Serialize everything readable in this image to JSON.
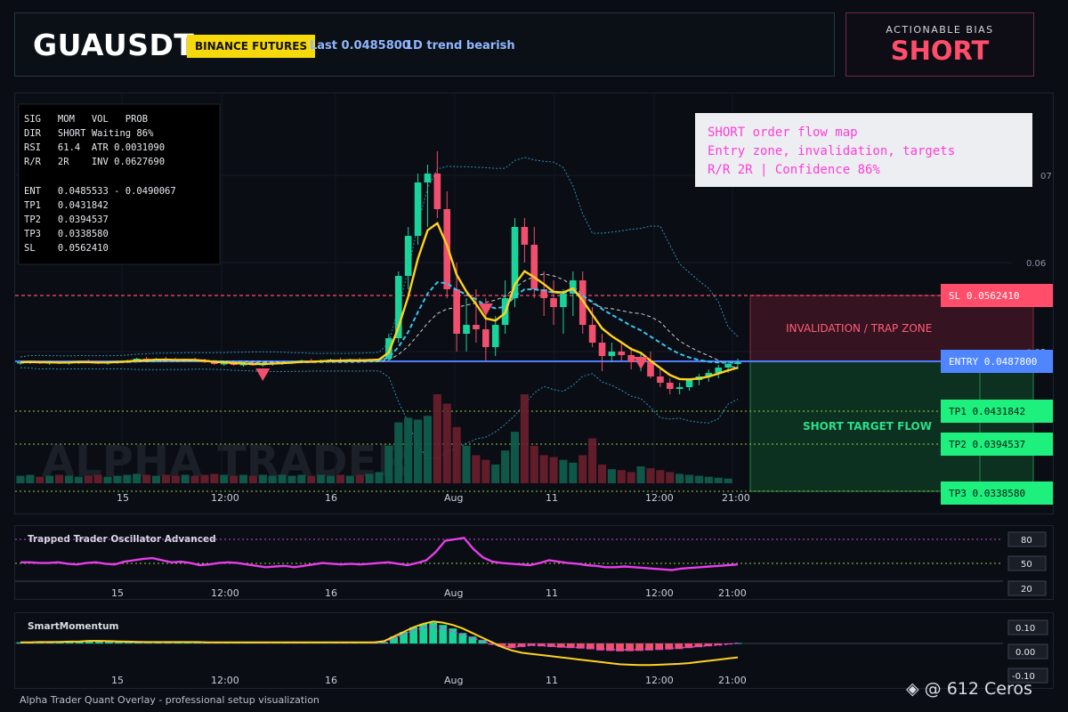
{
  "header": {
    "symbol": "GUAUSDT",
    "exchange": "BINANCE FUTURES",
    "last": "Last 0.0485800",
    "trend": "1D trend bearish"
  },
  "bias": {
    "label": "ACTIONABLE BIAS",
    "value": "SHORT"
  },
  "info_panel": {
    "lines": [
      "SIG   MOM   VOL   PROB",
      "DIR   SHORT Waiting 86%",
      "RSI   61.4  ATR 0.0031090",
      "R/R   2R    INV 0.0627690",
      "",
      "ENT   0.0485533 - 0.0490067",
      "TP1   0.0431842",
      "TP2   0.0394537",
      "TP3   0.0338580",
      "SL    0.0562410"
    ]
  },
  "note_box": {
    "lines": [
      "SHORT order flow map",
      "Entry zone, invalidation, targets",
      "R/R 2R | Confidence 86%"
    ]
  },
  "levels": {
    "sl": {
      "label": "SL 0.0562410",
      "value": 0.056241
    },
    "entry": {
      "label": "ENTRY 0.0487800",
      "value": 0.04878
    },
    "tp1": {
      "label": "TP1 0.0431842",
      "value": 0.0431842
    },
    "tp2": {
      "label": "TP2 0.0394537",
      "value": 0.0394537
    },
    "tp3": {
      "label": "TP3 0.0338580",
      "value": 0.033858
    }
  },
  "zones": {
    "invalidation": "INVALIDATION / TRAP ZONE",
    "target": "SHORT TARGET FLOW"
  },
  "watermark": "ALPHA TRADER",
  "chart_data": [
    {
      "type": "candlestick",
      "title": "GUAUSDT",
      "y_ticks": [
        "0.05",
        "0.06",
        "07"
      ],
      "x_ticks": [
        "15",
        "12:00",
        "16",
        "Aug",
        "11",
        "12:00",
        "21:00"
      ],
      "ohlc": [
        [
          0.0487,
          0.0489,
          0.0485,
          0.0488
        ],
        [
          0.0488,
          0.049,
          0.0486,
          0.0489
        ],
        [
          0.0489,
          0.049,
          0.0486,
          0.0487
        ],
        [
          0.0487,
          0.0489,
          0.0485,
          0.0488
        ],
        [
          0.0488,
          0.049,
          0.0486,
          0.0487
        ],
        [
          0.0487,
          0.0489,
          0.0485,
          0.0488
        ],
        [
          0.0488,
          0.049,
          0.0486,
          0.0489
        ],
        [
          0.0489,
          0.0491,
          0.0487,
          0.0488
        ],
        [
          0.0488,
          0.049,
          0.0486,
          0.0487
        ],
        [
          0.0487,
          0.0489,
          0.0485,
          0.0488
        ],
        [
          0.0488,
          0.049,
          0.0486,
          0.0489
        ],
        [
          0.0489,
          0.0491,
          0.0487,
          0.049
        ],
        [
          0.049,
          0.0493,
          0.0488,
          0.0492
        ],
        [
          0.0492,
          0.0494,
          0.049,
          0.0491
        ],
        [
          0.0491,
          0.0493,
          0.0489,
          0.0492
        ],
        [
          0.0492,
          0.0494,
          0.049,
          0.0491
        ],
        [
          0.0491,
          0.0493,
          0.0489,
          0.049
        ],
        [
          0.049,
          0.0492,
          0.0488,
          0.0491
        ],
        [
          0.0491,
          0.0493,
          0.0489,
          0.049
        ],
        [
          0.049,
          0.0492,
          0.0487,
          0.0488
        ],
        [
          0.0488,
          0.049,
          0.0485,
          0.0486
        ],
        [
          0.0486,
          0.0488,
          0.0484,
          0.0487
        ],
        [
          0.0487,
          0.0489,
          0.0484,
          0.0485
        ],
        [
          0.0485,
          0.0487,
          0.0483,
          0.0486
        ],
        [
          0.0486,
          0.0488,
          0.0484,
          0.0485
        ],
        [
          0.0485,
          0.0487,
          0.0483,
          0.0486
        ],
        [
          0.0486,
          0.0488,
          0.0484,
          0.0487
        ],
        [
          0.0487,
          0.0489,
          0.0485,
          0.0488
        ],
        [
          0.0488,
          0.049,
          0.0486,
          0.0489
        ],
        [
          0.0489,
          0.0491,
          0.0487,
          0.049
        ],
        [
          0.049,
          0.0492,
          0.0488,
          0.0489
        ],
        [
          0.0489,
          0.0491,
          0.0487,
          0.049
        ],
        [
          0.049,
          0.0492,
          0.0488,
          0.0491
        ],
        [
          0.0491,
          0.0493,
          0.0489,
          0.049
        ],
        [
          0.049,
          0.0492,
          0.0488,
          0.0491
        ],
        [
          0.0491,
          0.0493,
          0.0489,
          0.049
        ],
        [
          0.049,
          0.0492,
          0.0488,
          0.0491
        ],
        [
          0.0491,
          0.0493,
          0.0489,
          0.0492
        ],
        [
          0.0492,
          0.052,
          0.049,
          0.0515
        ],
        [
          0.0515,
          0.059,
          0.051,
          0.0585
        ],
        [
          0.0585,
          0.064,
          0.057,
          0.063
        ],
        [
          0.063,
          0.07,
          0.062,
          0.069
        ],
        [
          0.069,
          0.071,
          0.064,
          0.07
        ],
        [
          0.07,
          0.0725,
          0.065,
          0.066
        ],
        [
          0.066,
          0.068,
          0.056,
          0.057
        ],
        [
          0.057,
          0.06,
          0.05,
          0.052
        ],
        [
          0.052,
          0.056,
          0.05,
          0.053
        ],
        [
          0.053,
          0.057,
          0.051,
          0.0525
        ],
        [
          0.0525,
          0.056,
          0.049,
          0.0505
        ],
        [
          0.0505,
          0.054,
          0.0495,
          0.053
        ],
        [
          0.053,
          0.058,
          0.052,
          0.056
        ],
        [
          0.056,
          0.065,
          0.055,
          0.064
        ],
        [
          0.064,
          0.065,
          0.06,
          0.062
        ],
        [
          0.062,
          0.064,
          0.056,
          0.057
        ],
        [
          0.057,
          0.059,
          0.054,
          0.056
        ],
        [
          0.056,
          0.058,
          0.053,
          0.055
        ],
        [
          0.055,
          0.057,
          0.052,
          0.0565
        ],
        [
          0.0565,
          0.059,
          0.054,
          0.058
        ],
        [
          0.058,
          0.059,
          0.052,
          0.053
        ],
        [
          0.053,
          0.055,
          0.0505,
          0.051
        ],
        [
          0.051,
          0.052,
          0.0478,
          0.0495
        ],
        [
          0.0495,
          0.051,
          0.0488,
          0.05
        ],
        [
          0.05,
          0.051,
          0.049,
          0.0496
        ],
        [
          0.0496,
          0.0505,
          0.048,
          0.0488
        ],
        [
          0.0488,
          0.05,
          0.0478,
          0.049
        ],
        [
          0.049,
          0.05,
          0.047,
          0.0472
        ],
        [
          0.0472,
          0.048,
          0.046,
          0.0465
        ],
        [
          0.0465,
          0.047,
          0.0452,
          0.0458
        ],
        [
          0.0458,
          0.0465,
          0.0452,
          0.046
        ],
        [
          0.046,
          0.047,
          0.0456,
          0.0468
        ],
        [
          0.0468,
          0.0475,
          0.0462,
          0.0472
        ],
        [
          0.0472,
          0.048,
          0.0466,
          0.0476
        ],
        [
          0.0476,
          0.0485,
          0.047,
          0.0482
        ],
        [
          0.0482,
          0.049,
          0.0476,
          0.0486
        ],
        [
          0.0486,
          0.0492,
          0.048,
          0.0488
        ]
      ],
      "volume": [
        8,
        9,
        7,
        8,
        9,
        8,
        7,
        8,
        9,
        7,
        8,
        9,
        10,
        9,
        8,
        9,
        8,
        9,
        8,
        9,
        10,
        9,
        8,
        9,
        8,
        9,
        8,
        9,
        8,
        9,
        8,
        9,
        8,
        9,
        8,
        9,
        10,
        12,
        40,
        65,
        70,
        68,
        72,
        95,
        85,
        60,
        40,
        30,
        25,
        20,
        35,
        55,
        95,
        40,
        30,
        28,
        25,
        22,
        30,
        48,
        20,
        15,
        14,
        12,
        18,
        16,
        14,
        12,
        10,
        9,
        8,
        7,
        6,
        5
      ],
      "signals": [
        {
          "index": 25,
          "direction": "down"
        },
        {
          "index": 48,
          "direction": "down"
        },
        {
          "index": 64,
          "direction": "down"
        }
      ]
    },
    {
      "type": "line",
      "title": "Trapped Trader Oscillator Advanced",
      "y_ticks": [
        "80",
        "50",
        "20"
      ],
      "ylim": [
        10,
        95
      ],
      "values": [
        47,
        47,
        46,
        46,
        47,
        45,
        44,
        46,
        47,
        45,
        44,
        48,
        50,
        52,
        53,
        50,
        47,
        48,
        46,
        43,
        44,
        46,
        47,
        46,
        44,
        42,
        40,
        41,
        42,
        40,
        42,
        44,
        46,
        45,
        44,
        45,
        44,
        45,
        46,
        47,
        45,
        43,
        46,
        50,
        62,
        78,
        80,
        82,
        66,
        54,
        48,
        46,
        45,
        44,
        43,
        46,
        50,
        48,
        46,
        45,
        43,
        42,
        40,
        40,
        41,
        40,
        39,
        38,
        37,
        36,
        38,
        39,
        40,
        41,
        42,
        43,
        44
      ]
    },
    {
      "type": "bar",
      "title": "SmartMomentum",
      "y_ticks": [
        "0.10",
        "0.00",
        "-0.10"
      ],
      "ylim": [
        -0.12,
        0.12
      ],
      "histogram": [
        0.005,
        0.004,
        0.006,
        0.005,
        0.007,
        0.008,
        0.01,
        0.012,
        0.011,
        0.009,
        0.008,
        0.007,
        0.006,
        0.005,
        0.006,
        0.005,
        0.006,
        0.007,
        0.006,
        0.005,
        0.004,
        0.005,
        0.006,
        0.005,
        0.004,
        0.005,
        0.006,
        0.005,
        0.004,
        0.005,
        0.006,
        0.005,
        0.004,
        0.005,
        0.006,
        0.005,
        0.004,
        0.006,
        0.03,
        0.05,
        0.07,
        0.085,
        0.09,
        0.08,
        0.065,
        0.045,
        0.03,
        0.015,
        -0.005,
        -0.015,
        -0.02,
        -0.015,
        -0.01,
        -0.012,
        -0.015,
        -0.018,
        -0.02,
        -0.022,
        -0.025,
        -0.03,
        -0.032,
        -0.034,
        -0.033,
        -0.032,
        -0.03,
        -0.028,
        -0.026,
        -0.024,
        -0.02,
        -0.016,
        -0.012,
        -0.008,
        -0.004,
        0.002
      ],
      "signal_line": [
        0.005,
        0.005,
        0.006,
        0.006,
        0.007,
        0.008,
        0.009,
        0.011,
        0.011,
        0.01,
        0.009,
        0.008,
        0.007,
        0.006,
        0.006,
        0.006,
        0.006,
        0.006,
        0.006,
        0.005,
        0.005,
        0.005,
        0.005,
        0.005,
        0.005,
        0.005,
        0.005,
        0.005,
        0.005,
        0.005,
        0.005,
        0.005,
        0.005,
        0.005,
        0.005,
        0.005,
        0.005,
        0.01,
        0.03,
        0.05,
        0.07,
        0.085,
        0.095,
        0.09,
        0.08,
        0.065,
        0.045,
        0.025,
        0.005,
        -0.015,
        -0.03,
        -0.04,
        -0.045,
        -0.05,
        -0.055,
        -0.06,
        -0.065,
        -0.07,
        -0.075,
        -0.08,
        -0.085,
        -0.09,
        -0.092,
        -0.093,
        -0.093,
        -0.092,
        -0.09,
        -0.088,
        -0.085,
        -0.08,
        -0.075,
        -0.07,
        -0.065,
        -0.06
      ]
    }
  ]
}
